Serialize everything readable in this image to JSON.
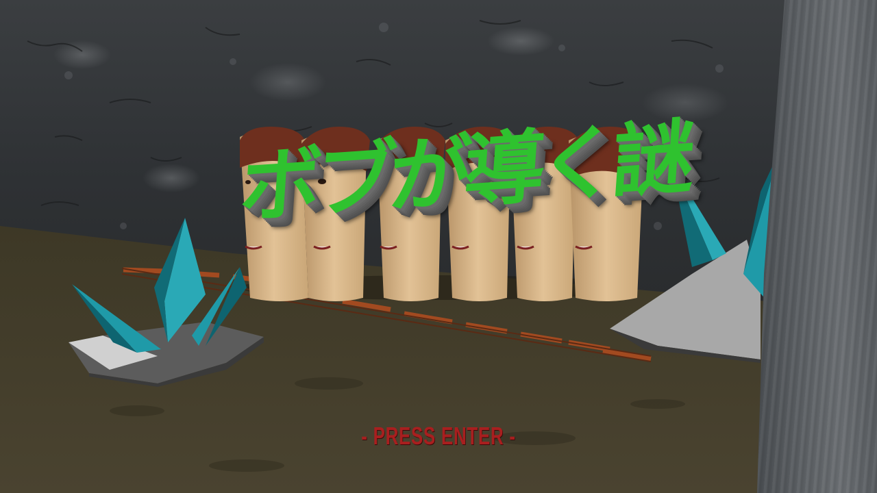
{
  "screen": "title-screen",
  "title": {
    "text": "ボブが導く謎",
    "color": "#2fc22f",
    "extrude_color": "#6b6b6b"
  },
  "prompt": {
    "text": "- PRESS ENTER -",
    "color": "#a81f1f"
  },
  "scene": {
    "heads_count": 6,
    "crystal_color": "#1f9aa8",
    "rail_color": "#8a3a1a"
  }
}
